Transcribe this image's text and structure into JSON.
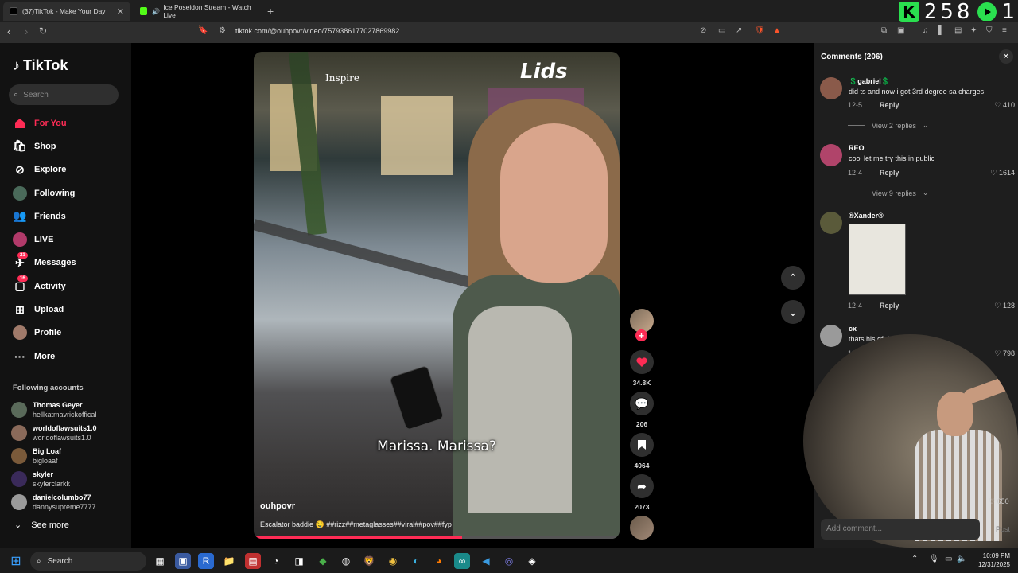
{
  "browser": {
    "tabs": [
      {
        "label": "(37)TikTok - Make Your Day",
        "color": "#111111"
      },
      {
        "label": "Ice Poseidon Stream - Watch Live",
        "color": "#53fc18"
      }
    ],
    "url": "tiktok.com/@ouhpovr/video/7579386177027869982",
    "overlay_counter": "258",
    "overlay_k": "K",
    "overlay_tail": "1"
  },
  "sidebar": {
    "logo": "TikTok",
    "search_placeholder": "Search",
    "menu": [
      {
        "label": "For You",
        "icon": "home-icon"
      },
      {
        "label": "Shop",
        "icon": "shop-icon"
      },
      {
        "label": "Explore",
        "icon": "compass-icon"
      },
      {
        "label": "Following",
        "icon": "following-avatar-icon"
      },
      {
        "label": "Friends",
        "icon": "friends-icon"
      },
      {
        "label": "LIVE",
        "icon": "live-icon"
      },
      {
        "label": "Messages",
        "icon": "messages-icon",
        "badge": "21"
      },
      {
        "label": "Activity",
        "icon": "activity-icon",
        "badge": "16"
      },
      {
        "label": "Upload",
        "icon": "upload-icon"
      },
      {
        "label": "Profile",
        "icon": "profile-avatar-icon"
      },
      {
        "label": "More",
        "icon": "more-icon"
      }
    ],
    "following_title": "Following accounts",
    "following": [
      {
        "name": "Thomas Geyer",
        "handle": "hellkatmavrickoffical"
      },
      {
        "name": "worldoflawsuits1.0",
        "handle": "worldoflawsuits1.0"
      },
      {
        "name": "Big Loaf",
        "handle": "bigloaaf"
      },
      {
        "name": "skyler",
        "handle": "skylerclarkk"
      },
      {
        "name": "danielcolumbo77",
        "handle": "dannysupreme7777"
      }
    ],
    "see_more": "See more"
  },
  "video": {
    "store_sign": "Lids",
    "store_sign2": "Inspire",
    "subtitle": "Marissa. Marissa?",
    "author": "ouhpovr",
    "description": "Escalator baddie 🤤 ##rizz##metaglasses##viral##pov##fyp",
    "progress": 0.57
  },
  "actions": {
    "likes": "34.8K",
    "comments": "206",
    "saves": "4064",
    "shares": "2073"
  },
  "comments": {
    "title": "Comments (206)",
    "items": [
      {
        "user": "💲gabriel💲",
        "text": "did ts and now i got 3rd degree sa charges",
        "date": "12-5",
        "reply": "Reply",
        "likes": "410",
        "view_replies": "View 2 replies"
      },
      {
        "user": "REO",
        "text": "cool let me try this in public",
        "date": "12-4",
        "reply": "Reply",
        "likes": "1614",
        "view_replies": "View 9 replies"
      },
      {
        "user": "®Xander®",
        "text": "",
        "date": "12-4",
        "reply": "Reply",
        "likes": "128"
      },
      {
        "user": "cx",
        "text": "thats his gf right...?",
        "date": "12-5",
        "reply": "Reply",
        "likes": "798"
      }
    ],
    "hidden_likes": "650",
    "add_placeholder": "Add comment...",
    "post_label": "Post"
  },
  "taskbar": {
    "search": "Search",
    "time": "10:09 PM",
    "date": "12/31/2025"
  }
}
